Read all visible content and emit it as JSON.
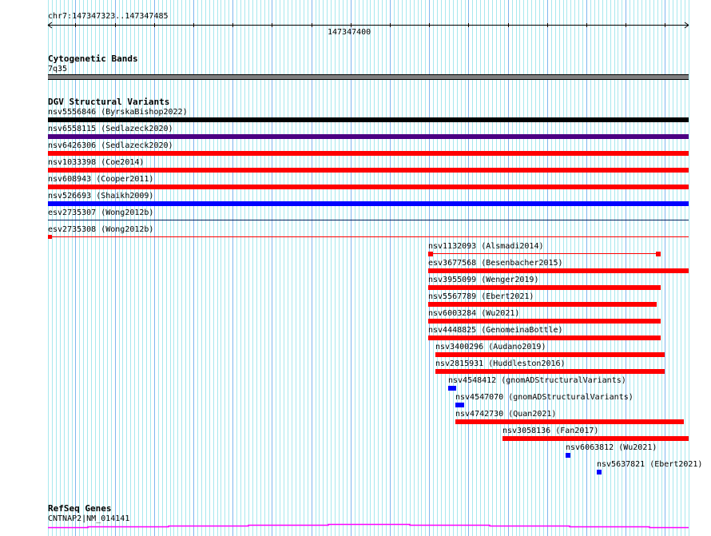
{
  "ruler": {
    "location": "chr7:147347323..147347485",
    "tick_label": "147347400"
  },
  "tracks": {
    "cyto": {
      "title": "Cytogenetic Bands",
      "band": "7q35",
      "color": "#808080"
    },
    "dgv": {
      "title": "DGV Structural Variants",
      "features": [
        {
          "label": "nsv5556846 (ByrskaBishop2022)",
          "color": "#000000"
        },
        {
          "label": "nsv6558115 (Sedlazeck2020)",
          "color": "#4b0082"
        },
        {
          "label": "nsv6426306 (Sedlazeck2020)",
          "color": "#ff0000"
        },
        {
          "label": "nsv1033398 (Coe2014)",
          "color": "#ff0000"
        },
        {
          "label": "nsv608943 (Cooper2011)",
          "color": "#ff0000"
        },
        {
          "label": "nsv526693 (Shaikh2009)",
          "color": "#0000ff"
        },
        {
          "label": "esv2735307 (Wong2012b)",
          "color": "#00205b"
        },
        {
          "label": "esv2735308 (Wong2012b)",
          "color": "#ff0000"
        },
        {
          "label": "nsv1132093 (Alsmadi2014)",
          "color": "#ff0000"
        },
        {
          "label": "esv3677568 (Besenbacher2015)",
          "color": "#ff0000"
        },
        {
          "label": "nsv3955099 (Wenger2019)",
          "color": "#ff0000"
        },
        {
          "label": "nsv5567789 (Ebert2021)",
          "color": "#ff0000"
        },
        {
          "label": "nsv6003284 (Wu2021)",
          "color": "#ff0000"
        },
        {
          "label": "nsv4448825 (GenomeinaBottle)",
          "color": "#ff0000"
        },
        {
          "label": "nsv3400296 (Audano2019)",
          "color": "#ff0000"
        },
        {
          "label": "nsv2815931 (Huddleston2016)",
          "color": "#ff0000"
        },
        {
          "label": "nsv4548412 (gnomADStructuralVariants)",
          "color": "#0000ff"
        },
        {
          "label": "nsv4547070 (gnomADStructuralVariants)",
          "color": "#0000ff"
        },
        {
          "label": "nsv4742730 (Quan2021)",
          "color": "#ff0000"
        },
        {
          "label": "nsv3058136 (Fan2017)",
          "color": "#ff0000"
        },
        {
          "label": "nsv6063812 (Wu2021)",
          "color": "#0000ff"
        },
        {
          "label": "nsv5637821 (Ebert2021)",
          "color": "#0000ff"
        }
      ]
    },
    "refseq": {
      "title": "RefSeq Genes",
      "gene": "CNTNAP2|NM_014141",
      "color": "#ff00ff"
    }
  }
}
